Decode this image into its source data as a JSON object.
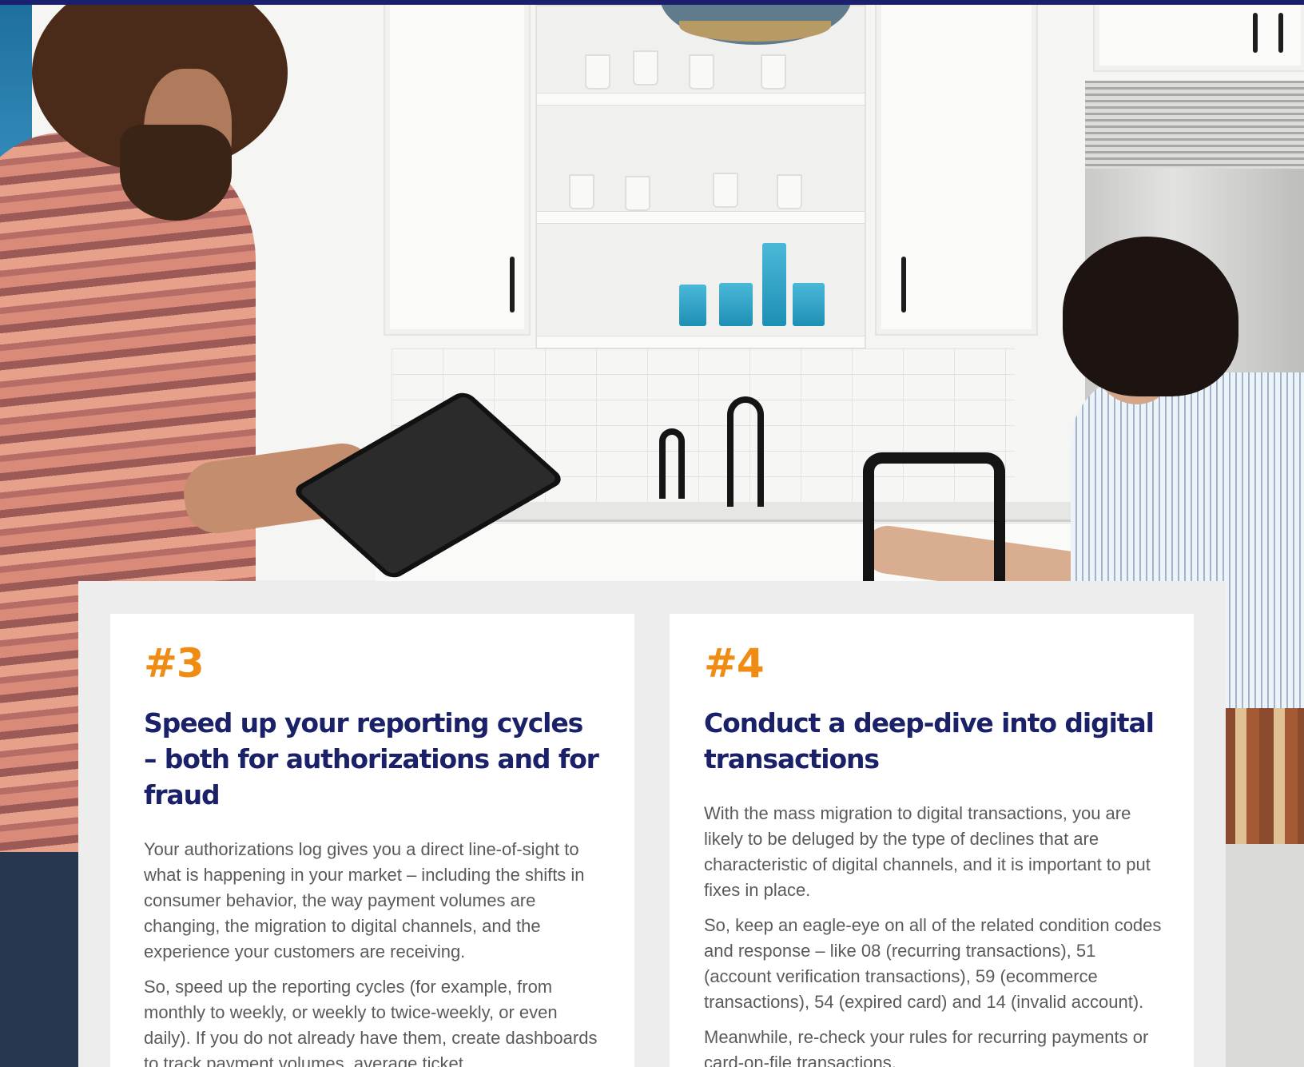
{
  "colors": {
    "top_bar": "#1a1f6e",
    "number_accent": "#f08c13",
    "heading": "#1b2169",
    "body_text": "#5a5a5a",
    "panel_bg": "#ededed",
    "card_bg": "#ffffff"
  },
  "tips": [
    {
      "number": "#3",
      "heading": "Speed up your reporting cycles – both for authorizations and for fraud",
      "paragraphs": [
        "Your authorizations log gives you a direct line-of-sight to what is happening in your market – including the shifts in consumer behavior, the way payment volumes are changing, the migration to digital channels, and the experience your customers are receiving.",
        "So, speed up the reporting cycles (for example, from monthly to weekly, or weekly to twice-weekly, or even daily). If you do not already have them, create dashboards to track payment volumes, average ticket"
      ]
    },
    {
      "number": "#4",
      "heading": "Conduct a deep-dive into digital transactions",
      "paragraphs": [
        "With the mass migration to digital transactions, you are likely to be deluged by the type of declines that are characteristic of digital channels, and it is important to put fixes in place.",
        "So, keep an eagle-eye on all of the related condition codes and response – like 08 (recurring transactions), 51 (account verification transactions), 59 (ecommerce transactions), 54 (expired card) and 14 (invalid account).",
        "Meanwhile, re-check your rules for recurring payments or card-on-file transactions."
      ]
    }
  ]
}
